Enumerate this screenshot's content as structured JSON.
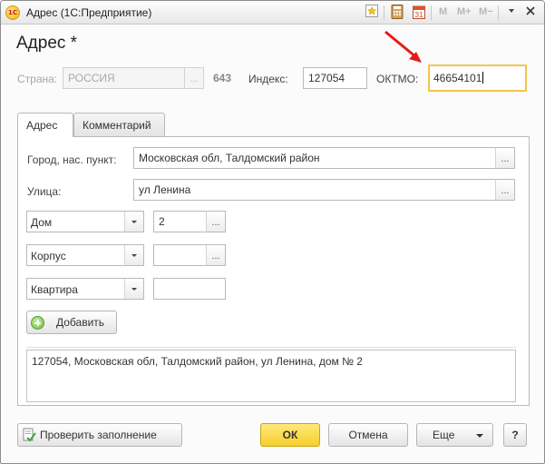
{
  "window": {
    "title": "Адрес  (1С:Предприятие)",
    "app_icon": "1С",
    "memory_buttons": [
      "M",
      "M+",
      "M−"
    ]
  },
  "form": {
    "title": "Адрес *",
    "country_label": "Страна:",
    "country_value": "РОССИЯ",
    "country_code": "643",
    "index_label": "Индекс:",
    "index_value": "127054",
    "oktmo_label": "ОКТМО:",
    "oktmo_value": "46654101"
  },
  "tabs": [
    {
      "label": "Адрес",
      "active": true
    },
    {
      "label": "Комментарий",
      "active": false
    }
  ],
  "address": {
    "city_label": "Город, нас. пункт:",
    "city_value": "Московская обл, Талдомский район",
    "street_label": "Улица:",
    "street_value": "ул Ленина",
    "rows": [
      {
        "type": "Дом",
        "value": "2"
      },
      {
        "type": "Корпус",
        "value": ""
      },
      {
        "type": "Квартира",
        "value": ""
      }
    ],
    "add_button": "Добавить",
    "full_address": "127054, Московская обл, Талдомский район, ул Ленина, дом № 2"
  },
  "footer": {
    "check_button": "Проверить заполнение",
    "ok_button": "ОК",
    "cancel_button": "Отмена",
    "more_button": "Еще",
    "help_button": "?"
  },
  "annotation_color": "#e31b1b",
  "ellipsis": "..."
}
